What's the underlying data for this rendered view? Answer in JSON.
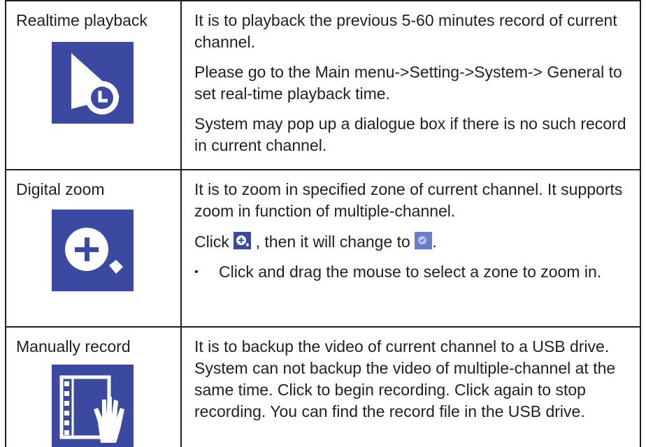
{
  "rows": [
    {
      "feature": "Realtime playback",
      "icon": "realtime-playback-icon",
      "paragraphs": [
        "It is to playback the previous 5-60 minutes record of current channel.",
        "Please go to the Main menu->Setting->System-> General to set real-time playback time.",
        "System may pop up a dialogue box if there is no such record in current channel."
      ]
    },
    {
      "feature": "Digital zoom",
      "icon": "digital-zoom-icon",
      "paragraphs": [
        "It is to zoom in specified zone of current channel. It supports zoom in function of multiple-channel."
      ],
      "click_prefix": "Click",
      "click_middle": " , then it will change to",
      "click_suffix": ".",
      "bullet": "Click and drag the mouse to select a zone to zoom in."
    },
    {
      "feature": "Manually record",
      "icon": "manual-record-icon",
      "paragraphs": [
        "It is to backup the video of current channel to a USB drive. System can not backup the video of multiple-channel at the same time. Click to begin recording. Click again to stop recording. You can find the record file in the USB drive."
      ]
    }
  ],
  "colors": {
    "icon_bg": "#3b4aa0",
    "text": "#231f20",
    "border": "#231f20"
  }
}
